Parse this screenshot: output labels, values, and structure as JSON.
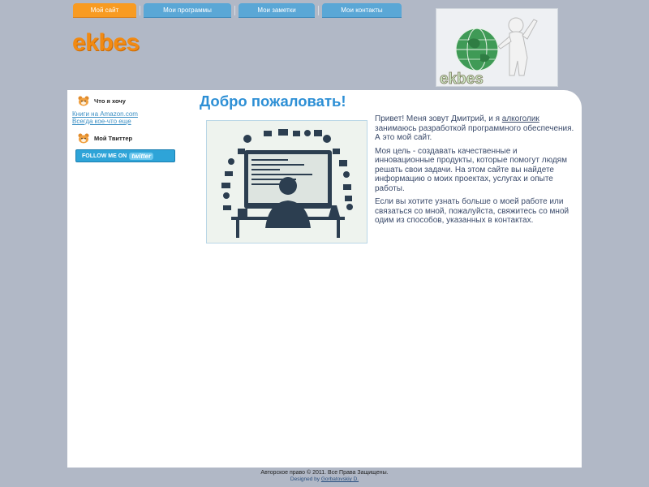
{
  "nav": {
    "tabs": [
      {
        "label": "Мой сайт",
        "active": true
      },
      {
        "label": "Мои программы",
        "active": false
      },
      {
        "label": "Мои заметки",
        "active": false
      },
      {
        "label": "Мои контакты",
        "active": false
      }
    ]
  },
  "site": {
    "logo": "ekbes",
    "mascot_caption": "ekbes"
  },
  "sidebar": {
    "wishlist_title": "Что я хочу",
    "links": [
      "Книги на Amazon.com",
      "Всегда кое-что еще"
    ],
    "twitter_title": "Мой Твиттер",
    "twitter_button": "FOLLOW ME ON",
    "twitter_brand": "twitter"
  },
  "main": {
    "title": "Добро пожаловать!",
    "p1_before": "Привет! Меня зовут Дмитрий, и я ",
    "p1_link": "алкоголик",
    "p1_after": " занимаюсь разработкой программного обеспечения. А это мой сайт.",
    "p2": "Моя цель - создавать качественные и инновационные продукты, которые помогут людям решать свои задачи. На этом сайте вы найдете информацию о моих проектах, услугах и опыте работы.",
    "p3": "Если вы хотите узнать больше о моей работе или связаться со мной, пожалуйста, свяжитесь со мной одим из способов, указанных в контактах."
  },
  "footer": {
    "copyright": "Авторское право © 2011. Все Права Защищены.",
    "designed_by": "Designed by ",
    "designer": "Gorbatovskiy D."
  },
  "colors": {
    "background": "#b1b8c6",
    "tab_active": "#f89b22",
    "tab": "#5aa7d6",
    "logo": "#f28a12",
    "title": "#2d8fd5"
  }
}
